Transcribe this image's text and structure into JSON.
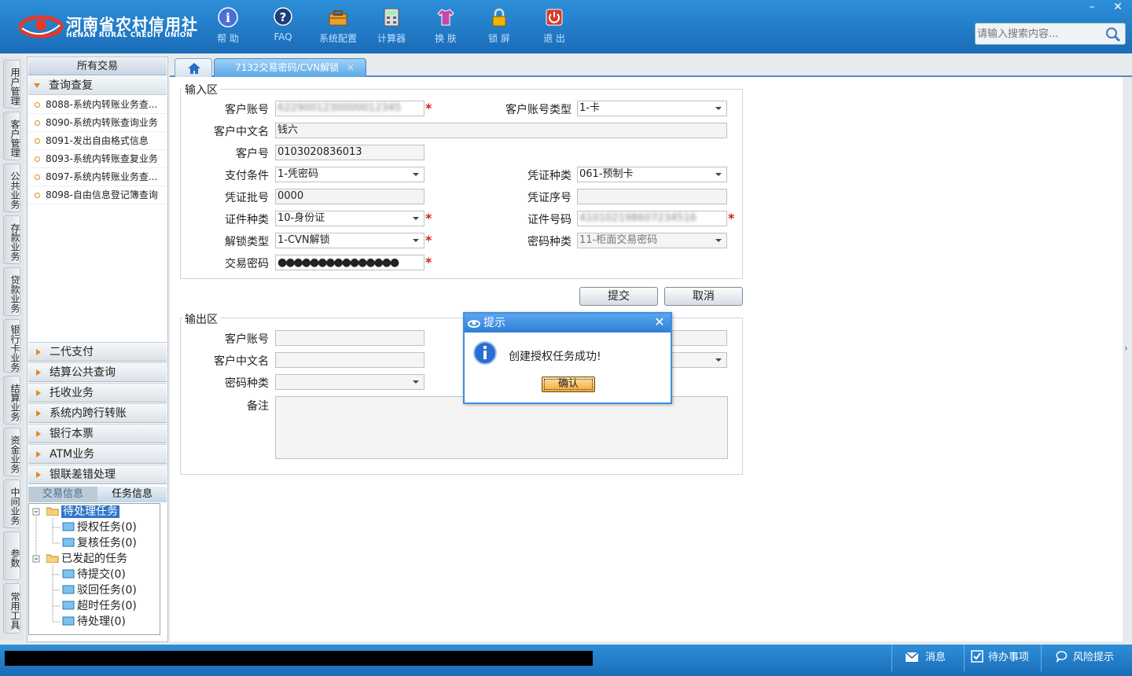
{
  "brand": {
    "name_cn": "河南省农村信用社",
    "name_en": "HENAN RURAL CREDIT UNION"
  },
  "toolbar": [
    {
      "label": "帮 助",
      "icon": "help-icon"
    },
    {
      "label": "FAQ",
      "icon": "faq-icon"
    },
    {
      "label": "系统配置",
      "icon": "toolbox-icon"
    },
    {
      "label": "计算器",
      "icon": "calculator-icon"
    },
    {
      "label": "换 肤",
      "icon": "shirt-icon"
    },
    {
      "label": "锁 屏",
      "icon": "lock-icon"
    },
    {
      "label": "退 出",
      "icon": "power-icon"
    }
  ],
  "search": {
    "placeholder": "请输入搜索内容..."
  },
  "vertical_nav": [
    "用户管理",
    "客户管理",
    "公共业务",
    "存款业务",
    "贷款业务",
    "银行卡业务",
    "结算业务",
    "资金业务",
    "中间业务",
    "参数",
    "常用工具"
  ],
  "sidebar": {
    "title": "所有交易",
    "open_group": "查询查复",
    "items": [
      "8088-系统内转账业务查...",
      "8090-系统内转账查询业务",
      "8091-发出自由格式信息",
      "8093-系统内转账查复业务",
      "8097-系统内转账业务查...",
      "8098-自由信息登记簿查询"
    ],
    "groups": [
      "二代支付",
      "结算公共查询",
      "托收业务",
      "系统内跨行转账",
      "银行本票",
      "ATM业务",
      "银联差错处理"
    ],
    "bottom_tabs": {
      "trans": "交易信息",
      "task": "任务信息"
    },
    "tree": {
      "pending": "待处理任务",
      "pending_children": [
        "授权任务(0)",
        "复核任务(0)"
      ],
      "initiated": "已发起的任务",
      "initiated_children": [
        "待提交(0)",
        "驳回任务(0)",
        "超时任务(0)",
        "待处理(0)"
      ]
    }
  },
  "tab": {
    "active": "7132交易密码/CVN解锁"
  },
  "input_area": {
    "legend": "输入区",
    "labels": {
      "account": "客户账号",
      "account_type": "客户账号类型",
      "cn_name": "客户中文名",
      "cust_no": "客户号",
      "pay_cond": "支付条件",
      "voucher_type": "凭证种类",
      "voucher_batch": "凭证批号",
      "voucher_seq": "凭证序号",
      "id_type": "证件种类",
      "id_no": "证件号码",
      "unlock_type": "解锁类型",
      "pwd_type": "密码种类",
      "trans_pwd": "交易密码"
    },
    "values": {
      "account": "6229001230000012345",
      "account_type": "1-卡",
      "cn_name": "钱六",
      "cust_no": "0103020836013",
      "pay_cond": "1-凭密码",
      "voucher_type": "061-预制卡",
      "voucher_batch": "0000",
      "voucher_seq": "",
      "id_type": "10-身份证",
      "id_no": "410102198607234516",
      "unlock_type": "1-CVN解锁",
      "pwd_type": "11-柜面交易密码",
      "trans_pwd": "●●●●●●●●●●●●●●●"
    }
  },
  "buttons": {
    "submit": "提交",
    "cancel": "取消"
  },
  "output_area": {
    "legend": "输出区",
    "labels": {
      "account": "客户账号",
      "cn_name": "客户中文名",
      "pwd_type": "密码种类",
      "remark": "备注"
    }
  },
  "dialog": {
    "title": "提示",
    "message": "创建授权任务成功!",
    "ok": "确认"
  },
  "statusbar": {
    "message": "消息",
    "todo": "待办事项",
    "risk": "风险提示"
  }
}
